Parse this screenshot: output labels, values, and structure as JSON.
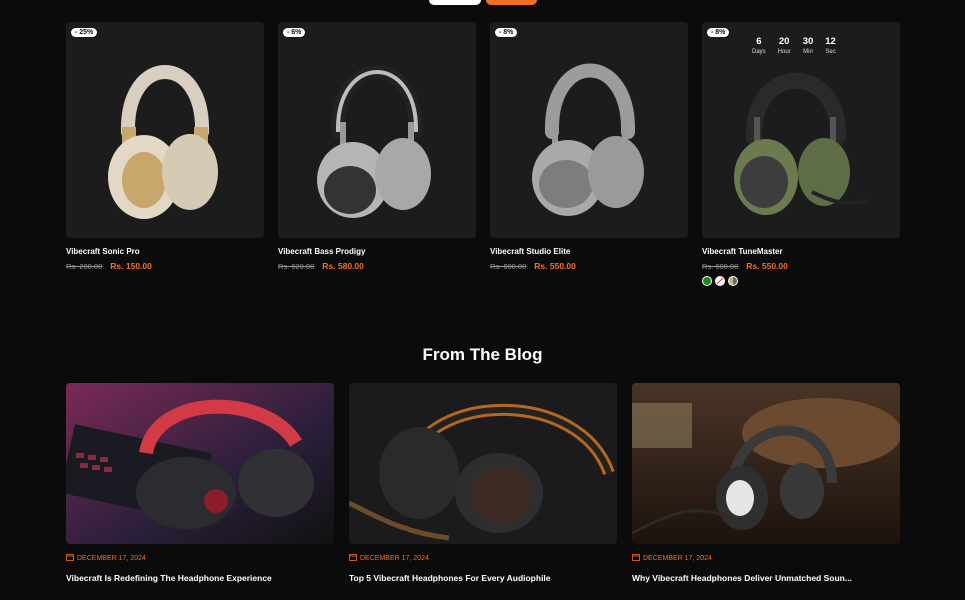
{
  "colors": {
    "accent": "#f36f21",
    "background": "#0b0b0b",
    "card": "#1c1c1c"
  },
  "products": [
    {
      "badge": "- 25%",
      "name": "Vibecraft Sonic Pro",
      "old_price": "Rs. 200.00",
      "new_price": "Rs. 150.00"
    },
    {
      "badge": "- 6%",
      "name": "Vibecraft Bass Prodigy",
      "old_price": "Rs. 620.00",
      "new_price": "Rs. 580.00"
    },
    {
      "badge": "- 8%",
      "name": "Vibecraft Studio Elite",
      "old_price": "Rs. 600.00",
      "new_price": "Rs. 550.00"
    },
    {
      "badge": "- 8%",
      "name": "Vibecraft TuneMaster",
      "old_price": "Rs. 600.00",
      "new_price": "Rs. 550.00"
    }
  ],
  "countdown": [
    {
      "value": "6",
      "label": "Days"
    },
    {
      "value": "20",
      "label": "Hour"
    },
    {
      "value": "30",
      "label": "Min"
    },
    {
      "value": "12",
      "label": "Sec"
    }
  ],
  "swatch_colors": [
    "#1a8a1a",
    "#ffffff",
    "#c8b37a"
  ],
  "blog": {
    "heading": "From The Blog",
    "posts": [
      {
        "date": "DECEMBER 17, 2024",
        "title": "Vibecraft Is Redefining The Headphone Experience"
      },
      {
        "date": "DECEMBER 17, 2024",
        "title": "Top 5 Vibecraft Headphones For Every Audiophile"
      },
      {
        "date": "DECEMBER 17, 2024",
        "title": "Why Vibecraft Headphones Deliver Unmatched Soun..."
      }
    ]
  }
}
